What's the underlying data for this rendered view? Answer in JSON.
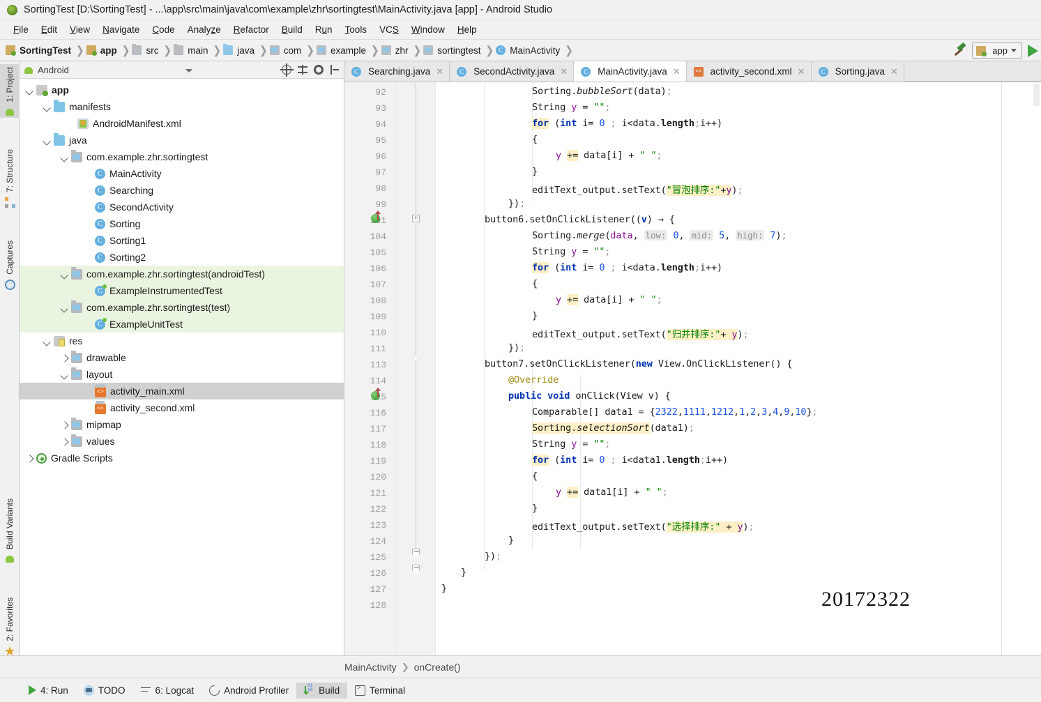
{
  "window": {
    "title": "SortingTest [D:\\SortingTest] - ...\\app\\src\\main\\java\\com\\example\\zhr\\sortingtest\\MainActivity.java [app] - Android Studio",
    "logo_icon": "android-studio-logo"
  },
  "menubar": [
    {
      "label": "File"
    },
    {
      "label": "Edit"
    },
    {
      "label": "View"
    },
    {
      "label": "Navigate"
    },
    {
      "label": "Code"
    },
    {
      "label": "Analyze"
    },
    {
      "label": "Refactor"
    },
    {
      "label": "Build"
    },
    {
      "label": "Run"
    },
    {
      "label": "Tools"
    },
    {
      "label": "VCS"
    },
    {
      "label": "Window"
    },
    {
      "label": "Help"
    }
  ],
  "breadcrumb": [
    {
      "label": "SortingTest",
      "icon": "module-icon",
      "bold": true
    },
    {
      "label": "app",
      "icon": "module-icon",
      "bold": true
    },
    {
      "label": "src",
      "icon": "folder-gray-icon",
      "bold": false
    },
    {
      "label": "main",
      "icon": "folder-gray-icon",
      "bold": false
    },
    {
      "label": "java",
      "icon": "folder-blue-icon",
      "bold": false
    },
    {
      "label": "com",
      "icon": "package-icon",
      "bold": false
    },
    {
      "label": "example",
      "icon": "package-icon",
      "bold": false
    },
    {
      "label": "zhr",
      "icon": "package-icon",
      "bold": false
    },
    {
      "label": "sortingtest",
      "icon": "package-icon",
      "bold": false
    },
    {
      "label": "MainActivity",
      "icon": "class-icon",
      "bold": false
    }
  ],
  "toolbar_right": {
    "build_icon": "hammer-icon",
    "run_config": "app",
    "run_config_icon": "module-icon",
    "dropdown_icon": "chevron-down-icon",
    "run_icon": "run-triangle-icon"
  },
  "left_strip": [
    {
      "label": "1: Project",
      "icon": "android-icon",
      "selected": true
    },
    {
      "label": "7: Structure",
      "icon": "structure-icon",
      "selected": false
    },
    {
      "label": "Captures",
      "icon": "captures-icon",
      "selected": false
    },
    {
      "label": "Build Variants",
      "icon": "android-green-icon",
      "selected": false
    },
    {
      "label": "2: Favorites",
      "icon": "star-icon",
      "selected": false
    }
  ],
  "project_panel": {
    "selector_label": "Android",
    "selector_icon": "android-icon",
    "toolbar_icons": [
      "target-icon",
      "collapse-all-icon",
      "gear-icon",
      "hide-icon"
    ],
    "tree": [
      {
        "label": "app",
        "depth": 0,
        "arrow": "down",
        "icon": "module-icon",
        "bold": true
      },
      {
        "label": "manifests",
        "depth": 1,
        "arrow": "down",
        "icon": "folder-blue-icon"
      },
      {
        "label": "AndroidManifest.xml",
        "depth": 2,
        "arrow": "none",
        "icon": "manifest-icon"
      },
      {
        "label": "java",
        "depth": 1,
        "arrow": "down",
        "icon": "folder-blue-icon"
      },
      {
        "label": "com.example.zhr.sortingtest",
        "depth": 2,
        "arrow": "down",
        "icon": "package-icon"
      },
      {
        "label": "MainActivity",
        "depth": 3,
        "arrow": "none",
        "icon": "class-icon"
      },
      {
        "label": "Searching",
        "depth": 3,
        "arrow": "none",
        "icon": "class-icon"
      },
      {
        "label": "SecondActivity",
        "depth": 3,
        "arrow": "none",
        "icon": "class-icon"
      },
      {
        "label": "Sorting",
        "depth": 3,
        "arrow": "none",
        "icon": "class-icon"
      },
      {
        "label": "Sorting1",
        "depth": 3,
        "arrow": "none",
        "icon": "class-icon"
      },
      {
        "label": "Sorting2",
        "depth": 3,
        "arrow": "none",
        "icon": "class-icon"
      },
      {
        "label": "com.example.zhr.sortingtest",
        "suffix": " (androidTest)",
        "depth": 2,
        "arrow": "down",
        "icon": "package-icon",
        "test": true
      },
      {
        "label": "ExampleInstrumentedTest",
        "depth": 3,
        "arrow": "none",
        "icon": "class-test-icon",
        "test": true
      },
      {
        "label": "com.example.zhr.sortingtest",
        "suffix": " (test)",
        "depth": 2,
        "arrow": "down",
        "icon": "package-icon",
        "test": true
      },
      {
        "label": "ExampleUnitTest",
        "depth": 3,
        "arrow": "none",
        "icon": "class-test-icon",
        "test": true
      },
      {
        "label": "res",
        "depth": 1,
        "arrow": "down",
        "icon": "res-icon"
      },
      {
        "label": "drawable",
        "depth": 2,
        "arrow": "right",
        "icon": "package-icon"
      },
      {
        "label": "layout",
        "depth": 2,
        "arrow": "down",
        "icon": "package-icon"
      },
      {
        "label": "activity_main.xml",
        "depth": 3,
        "arrow": "none",
        "icon": "xml-icon",
        "selected": true
      },
      {
        "label": "activity_second.xml",
        "depth": 3,
        "arrow": "none",
        "icon": "xml-icon"
      },
      {
        "label": "mipmap",
        "depth": 2,
        "arrow": "right",
        "icon": "package-icon"
      },
      {
        "label": "values",
        "depth": 2,
        "arrow": "right",
        "icon": "package-icon"
      },
      {
        "label": "Gradle Scripts",
        "depth": 0,
        "arrow": "right",
        "icon": "gradle-icon"
      }
    ]
  },
  "editor_tabs": [
    {
      "label": "Searching.java",
      "icon": "class-icon",
      "active": false
    },
    {
      "label": "SecondActivity.java",
      "icon": "class-icon",
      "active": false
    },
    {
      "label": "MainActivity.java",
      "icon": "class-icon",
      "active": true
    },
    {
      "label": "activity_second.xml",
      "icon": "xml-icon",
      "active": false
    },
    {
      "label": "Sorting.java",
      "icon": "class-icon",
      "active": false
    }
  ],
  "editor": {
    "line_numbers": [
      "92",
      "93",
      "94",
      "95",
      "96",
      "97",
      "98",
      "99",
      "101",
      "104",
      "105",
      "106",
      "107",
      "108",
      "109",
      "110",
      "111",
      "113",
      "114",
      "115",
      "116",
      "117",
      "118",
      "119",
      "120",
      "121",
      "122",
      "123",
      "124",
      "125",
      "126",
      "127",
      "128"
    ],
    "watermark": "20172322",
    "code_text": [
      "        Sorting.bubbleSort(data);",
      "        String y = \"\";",
      "        for (int i= 0 ; i<data.length;i++)",
      "        {",
      "            y += data[i] + \" \";",
      "        }",
      "        editText_output.setText(\"冒泡排序:\"+y);",
      "    });",
      "button6.setOnClickListener((v) -> {",
      "        Sorting.merge(data, low: 0, mid: 5, high: 7);",
      "        String y = \"\";",
      "        for (int i= 0 ; i<data.length;i++)",
      "        {",
      "            y += data[i] + \" \";",
      "        }",
      "        editText_output.setText(\"归并排序:\"+ y);",
      "    });",
      "button7.setOnClickListener(new View.OnClickListener() {",
      "        @Override",
      "        public void onClick(View v) {",
      "            Comparable[] data1 = {2322,1111,1212,1,2,3,4,9,10};",
      "            Sorting.selectionSort(data1);",
      "            String y = \"\";",
      "            for (int i= 0 ; i<data1.length;i++)",
      "            {",
      "                y += data1[i] + \" \";",
      "            }",
      "            editText_output.setText(\"选择排序:\" + y);",
      "        }",
      "    });",
      "  }",
      " }",
      ""
    ]
  },
  "status_breadcrumb": [
    {
      "label": "MainActivity"
    },
    {
      "label": "onCreate()"
    }
  ],
  "statusbar": [
    {
      "label": "4: Run",
      "icon": "run-icon",
      "selected": false
    },
    {
      "label": "TODO",
      "icon": "todo-icon",
      "selected": false
    },
    {
      "label": "6: Logcat",
      "icon": "logcat-icon",
      "selected": false
    },
    {
      "label": "Android Profiler",
      "icon": "profiler-icon",
      "selected": false
    },
    {
      "label": "Build",
      "icon": "build-icon",
      "selected": true
    },
    {
      "label": "Terminal",
      "icon": "terminal-icon",
      "selected": false
    }
  ],
  "colors": {
    "keyword": "#0033b3",
    "number": "#1750eb",
    "string": "#008000",
    "field": "#871094",
    "annotation": "#9e880d",
    "highlight": "#fdf0c6",
    "accent_green": "#41a63f",
    "selection": "#d0d0d0",
    "test_scope": "#eaf5e1"
  }
}
